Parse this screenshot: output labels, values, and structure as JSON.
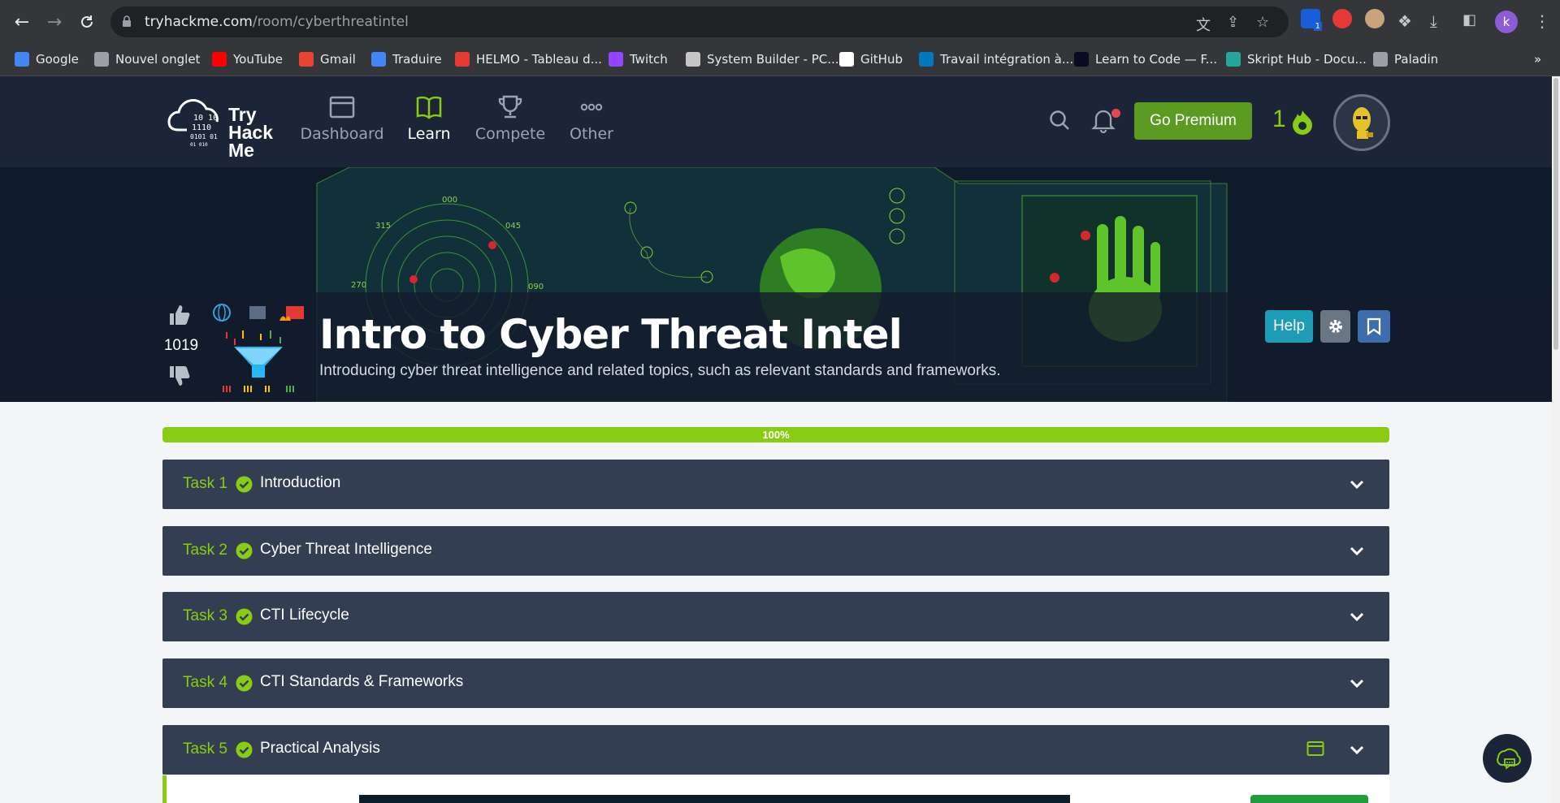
{
  "browser": {
    "url_host": "tryhackme.com",
    "url_path": "/room/cyberthreatintel",
    "profile_initial": "k",
    "extension_badge": "1"
  },
  "bookmarks": [
    {
      "label": "Google",
      "icon": "google-icon",
      "color": "#4285f4"
    },
    {
      "label": "Nouvel onglet",
      "icon": "globe-icon",
      "color": "#9aa0a6"
    },
    {
      "label": "YouTube",
      "icon": "youtube-icon",
      "color": "#ff0000"
    },
    {
      "label": "Gmail",
      "icon": "gmail-icon",
      "color": "#ea4335"
    },
    {
      "label": "Traduire",
      "icon": "translate-icon",
      "color": "#4285f4"
    },
    {
      "label": "HELMO - Tableau d...",
      "icon": "helmo-icon",
      "color": "#e53935"
    },
    {
      "label": "Twitch",
      "icon": "twitch-icon",
      "color": "#9146ff"
    },
    {
      "label": "System Builder - PC...",
      "icon": "pcpartpicker-icon",
      "color": "#c6c6c6"
    },
    {
      "label": "GitHub",
      "icon": "github-icon",
      "color": "#ffffff"
    },
    {
      "label": "Travail intégration à...",
      "icon": "trello-icon",
      "color": "#0079bf"
    },
    {
      "label": "Learn to Code — F...",
      "icon": "freecodecamp-icon",
      "color": "#0a0a23"
    },
    {
      "label": "Skript Hub - Docu...",
      "icon": "skripthub-icon",
      "color": "#26a69a"
    },
    {
      "label": "Paladin",
      "icon": "paladin-icon",
      "color": "#9aa0a6"
    }
  ],
  "header": {
    "logo_lines": [
      "Try",
      "Hack",
      "Me"
    ],
    "nav": [
      {
        "label": "Dashboard",
        "icon": "dashboard-icon",
        "active": false
      },
      {
        "label": "Learn",
        "icon": "book-icon",
        "active": true
      },
      {
        "label": "Compete",
        "icon": "trophy-icon",
        "active": false
      },
      {
        "label": "Other",
        "icon": "more-icon",
        "active": false
      }
    ],
    "premium_label": "Go Premium",
    "streak_count": "1"
  },
  "room": {
    "title": "Intro to Cyber Threat Intel",
    "description": "Introducing cyber threat intelligence and related topics, such as relevant standards and frameworks.",
    "votes": "1019",
    "help_label": "Help"
  },
  "progress": {
    "value": 1.0,
    "label": "100%"
  },
  "tasks": [
    {
      "number": "Task 1",
      "title": "Introduction",
      "completed": true
    },
    {
      "number": "Task 2",
      "title": "Cyber Threat Intelligence",
      "completed": true
    },
    {
      "number": "Task 3",
      "title": "CTI Lifecycle",
      "completed": true
    },
    {
      "number": "Task 4",
      "title": "CTI Standards & Frameworks",
      "completed": true
    },
    {
      "number": "Task 5",
      "title": "Practical Analysis",
      "completed": true
    }
  ],
  "colors": {
    "accent_green": "#88cc14",
    "header_bg": "#1c2538",
    "task_bg": "#343e52",
    "help_blue": "#1e9bb5"
  }
}
